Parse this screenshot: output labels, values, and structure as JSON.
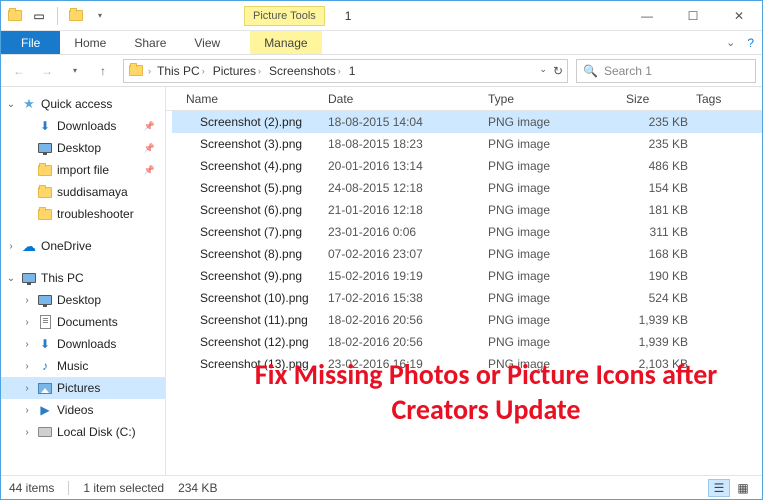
{
  "window": {
    "title": "1"
  },
  "context_tab": "Picture Tools",
  "ribbon": {
    "file": "File",
    "home": "Home",
    "share": "Share",
    "view": "View",
    "manage": "Manage"
  },
  "breadcrumbs": [
    "This PC",
    "Pictures",
    "Screenshots",
    "1"
  ],
  "search": {
    "placeholder": "Search 1"
  },
  "sidebar": {
    "quick_access": "Quick access",
    "downloads": "Downloads",
    "desktop": "Desktop",
    "import_file": "import file",
    "suddisamaya": "suddisamaya",
    "troubleshooter": "troubleshooter",
    "onedrive": "OneDrive",
    "this_pc": "This PC",
    "tp_desktop": "Desktop",
    "tp_documents": "Documents",
    "tp_downloads": "Downloads",
    "tp_music": "Music",
    "tp_pictures": "Pictures",
    "tp_videos": "Videos",
    "tp_localdisk": "Local Disk (C:)"
  },
  "columns": {
    "name": "Name",
    "date": "Date",
    "type": "Type",
    "size": "Size",
    "tags": "Tags"
  },
  "files": [
    {
      "name": "Screenshot (2).png",
      "date": "18-08-2015 14:04",
      "type": "PNG image",
      "size": "235 KB",
      "selected": true
    },
    {
      "name": "Screenshot (3).png",
      "date": "18-08-2015 18:23",
      "type": "PNG image",
      "size": "235 KB"
    },
    {
      "name": "Screenshot (4).png",
      "date": "20-01-2016 13:14",
      "type": "PNG image",
      "size": "486 KB"
    },
    {
      "name": "Screenshot (5).png",
      "date": "24-08-2015 12:18",
      "type": "PNG image",
      "size": "154 KB"
    },
    {
      "name": "Screenshot (6).png",
      "date": "21-01-2016 12:18",
      "type": "PNG image",
      "size": "181 KB"
    },
    {
      "name": "Screenshot (7).png",
      "date": "23-01-2016 0:06",
      "type": "PNG image",
      "size": "311 KB"
    },
    {
      "name": "Screenshot (8).png",
      "date": "07-02-2016 23:07",
      "type": "PNG image",
      "size": "168 KB"
    },
    {
      "name": "Screenshot (9).png",
      "date": "15-02-2016 19:19",
      "type": "PNG image",
      "size": "190 KB"
    },
    {
      "name": "Screenshot (10).png",
      "date": "17-02-2016 15:38",
      "type": "PNG image",
      "size": "524 KB"
    },
    {
      "name": "Screenshot (11).png",
      "date": "18-02-2016 20:56",
      "type": "PNG image",
      "size": "1,939 KB"
    },
    {
      "name": "Screenshot (12).png",
      "date": "18-02-2016 20:56",
      "type": "PNG image",
      "size": "1,939 KB"
    },
    {
      "name": "Screenshot (13).png",
      "date": "23-02-2016 16:19",
      "type": "PNG image",
      "size": "2,103 KB"
    }
  ],
  "overlay": "Fix Missing Photos or Picture Icons after Creators Update",
  "status": {
    "count": "44 items",
    "selected": "1 item selected",
    "size": "234 KB"
  }
}
